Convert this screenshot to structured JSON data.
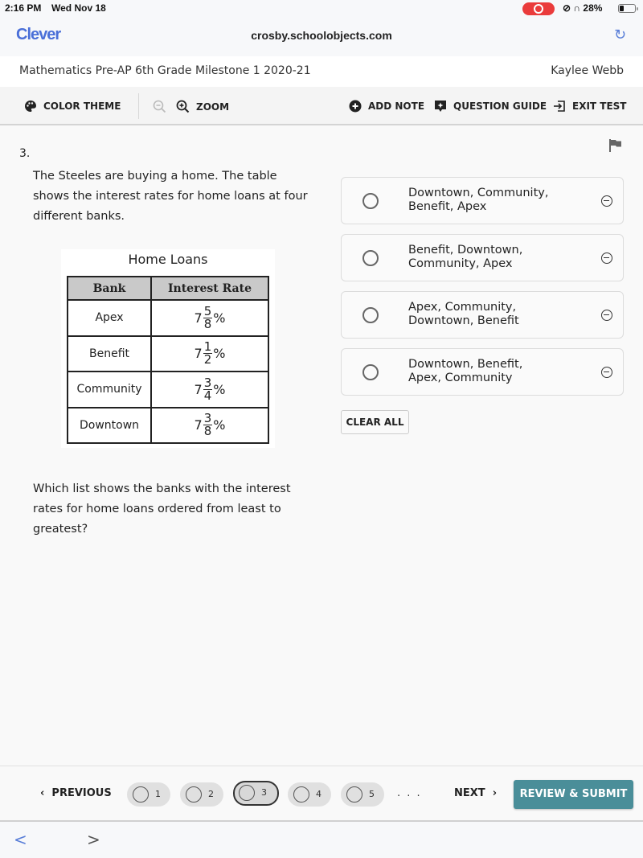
{
  "status_bar": {
    "time": "2:16 PM",
    "date": "Wed Nov 18",
    "battery_percent": "28%",
    "battery_level": 0.28,
    "recording_color": "#ea3b3b"
  },
  "browser": {
    "brand": "Clever",
    "url": "crosby.schoolobjects.com",
    "brand_color": "#4a6fd8",
    "reload_icon": "reload-icon",
    "back_icon": "chevron-left-icon",
    "forward_icon": "chevron-right-icon"
  },
  "test_header": {
    "title": "Mathematics Pre-AP 6th Grade Milestone 1 2020-21",
    "user": "Kaylee Webb"
  },
  "toolbar": {
    "color_theme": "COLOR THEME",
    "zoom": "ZOOM",
    "add_note": "ADD NOTE",
    "question_guide": "QUESTION GUIDE",
    "exit_test": "EXIT TEST"
  },
  "question": {
    "number": "3.",
    "stem": "The Steeles are buying a home. The table shows the interest rates for home loans at four different banks.",
    "prompt": "Which list shows the banks with the interest rates for home loans ordered from least to greatest?",
    "table": {
      "title": "Home Loans",
      "headers": [
        "Bank",
        "Interest Rate"
      ],
      "rows": [
        {
          "bank": "Apex",
          "whole": "7",
          "num": "5",
          "den": "8",
          "unit": "%"
        },
        {
          "bank": "Benefit",
          "whole": "7",
          "num": "1",
          "den": "2",
          "unit": "%"
        },
        {
          "bank": "Community",
          "whole": "7",
          "num": "3",
          "den": "4",
          "unit": "%"
        },
        {
          "bank": "Downtown",
          "whole": "7",
          "num": "3",
          "den": "8",
          "unit": "%"
        }
      ]
    },
    "choices": [
      {
        "line1": "Downtown, Community,",
        "line2": "Benefit, Apex"
      },
      {
        "line1": "Benefit, Downtown,",
        "line2": "Community, Apex"
      },
      {
        "line1": "Apex, Community,",
        "line2": "Downtown, Benefit"
      },
      {
        "line1": "Downtown, Benefit,",
        "line2": "Apex, Community"
      }
    ],
    "clear_all": "CLEAR ALL"
  },
  "navigation": {
    "previous": "PREVIOUS",
    "next": "NEXT",
    "pages": [
      "1",
      "2",
      "3",
      "4",
      "5"
    ],
    "current_page": "3",
    "ellipsis": ". . .",
    "submit": "REVIEW & SUBMIT",
    "submit_color": "#4a8e99"
  }
}
